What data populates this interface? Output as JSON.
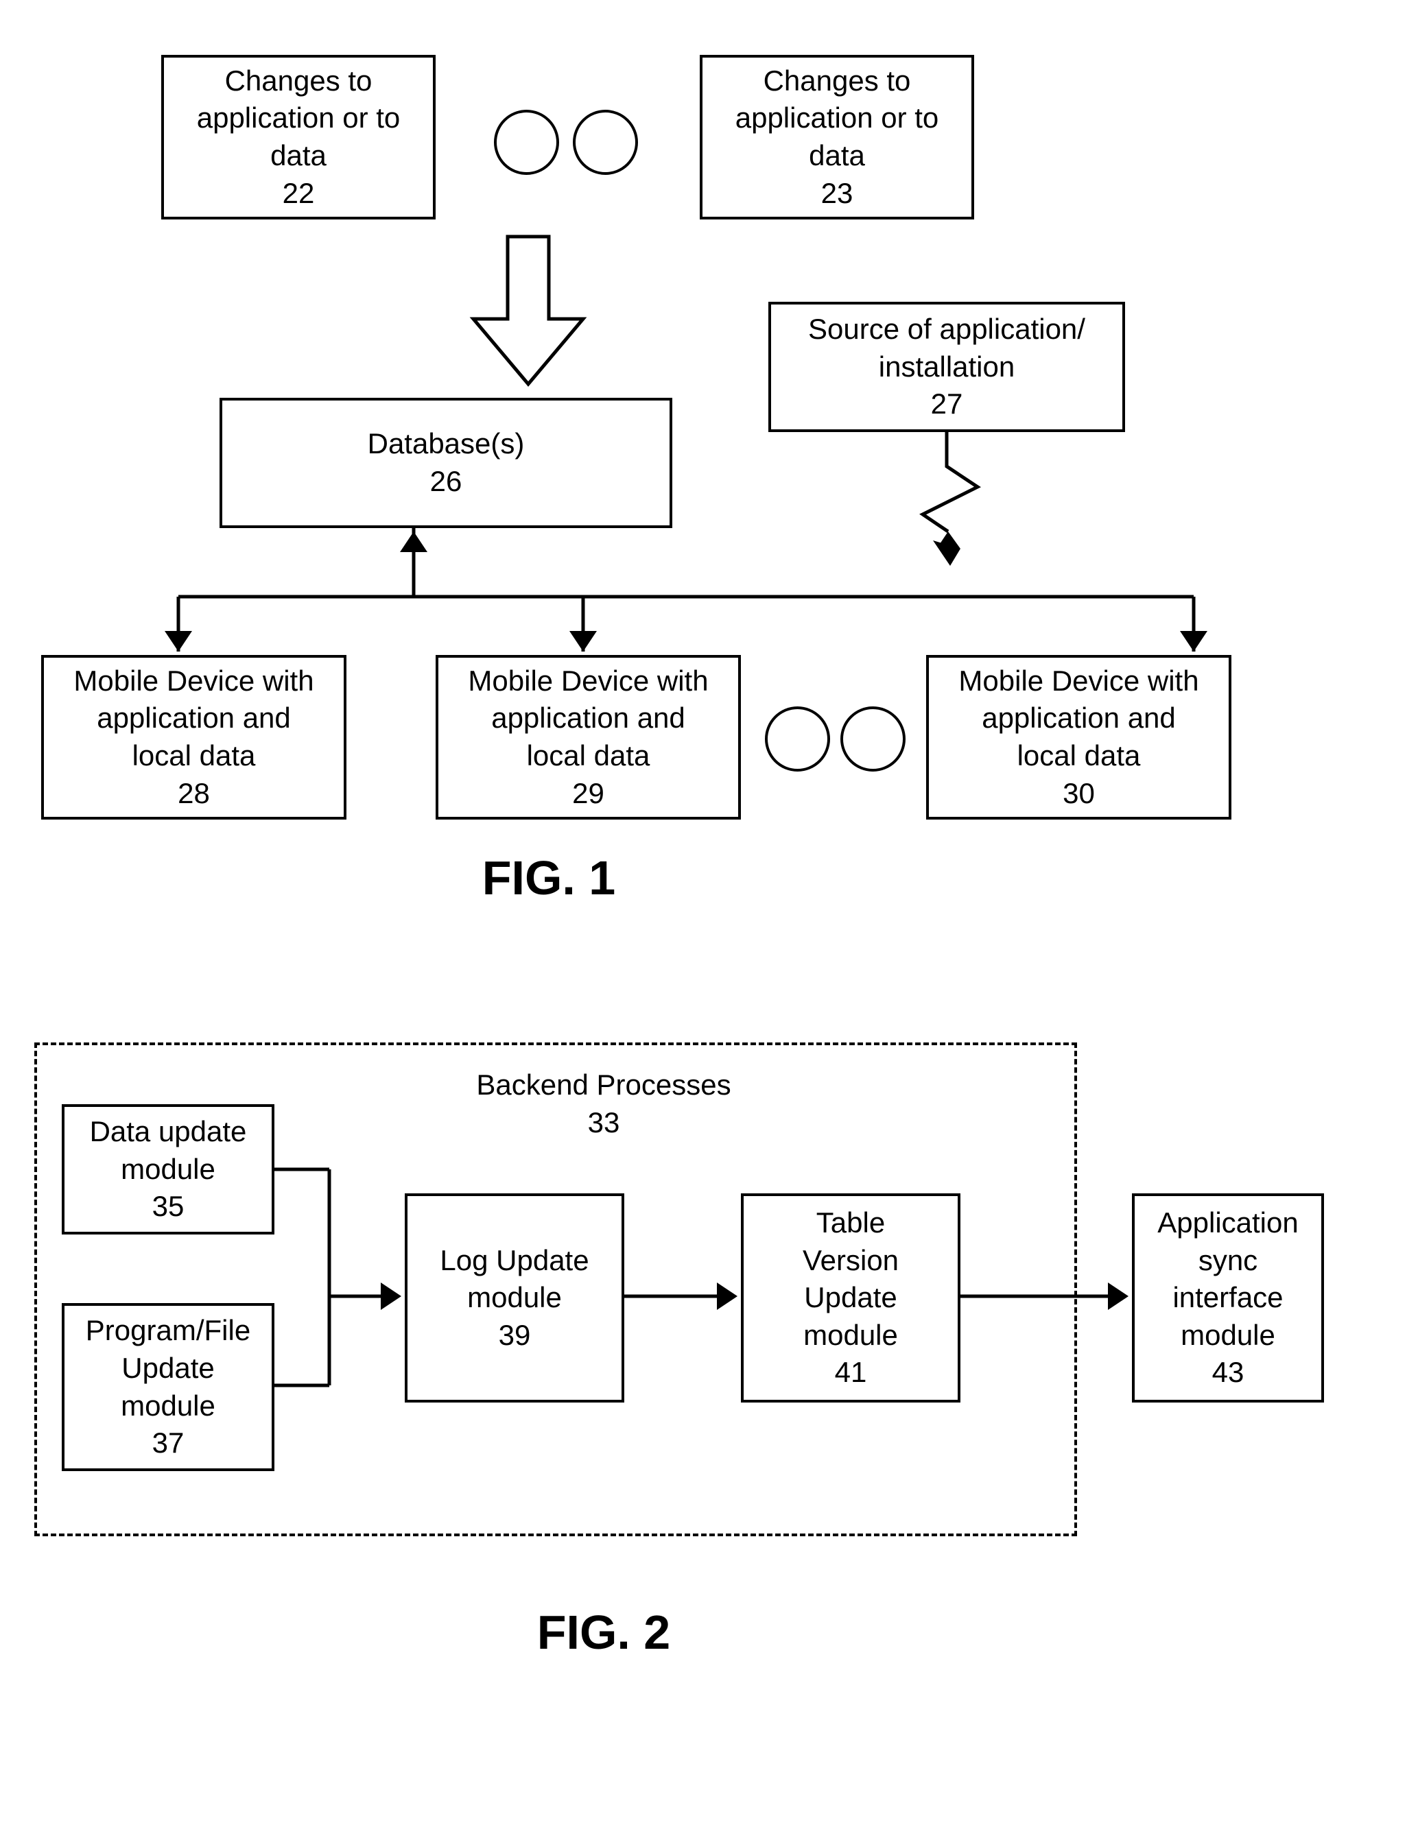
{
  "fig1": {
    "box22": {
      "line1": "Changes to",
      "line2": "application or to",
      "line3": "data",
      "num": "22"
    },
    "box23": {
      "line1": "Changes to",
      "line2": "application or to",
      "line3": "data",
      "num": "23"
    },
    "box26": {
      "line1": "Database(s)",
      "num": "26"
    },
    "box27": {
      "line1": "Source of application/",
      "line2": "installation",
      "num": "27"
    },
    "box28": {
      "line1": "Mobile Device with",
      "line2": "application and",
      "line3": "local data",
      "num": "28"
    },
    "box29": {
      "line1": "Mobile Device with",
      "line2": "application and",
      "line3": "local data",
      "num": "29"
    },
    "box30": {
      "line1": "Mobile Device with",
      "line2": "application and",
      "line3": "local data",
      "num": "30"
    },
    "label": "FIG. 1"
  },
  "fig2": {
    "title": {
      "line1": "Backend Processes",
      "num": "33"
    },
    "box35": {
      "line1": "Data update",
      "line2": "module",
      "num": "35"
    },
    "box37": {
      "line1": "Program/File",
      "line2": "Update",
      "line3": "module",
      "num": "37"
    },
    "box39": {
      "line1": "Log Update",
      "line2": "module",
      "num": "39"
    },
    "box41": {
      "line1": "Table",
      "line2": "Version",
      "line3": "Update",
      "line4": "module",
      "num": "41"
    },
    "box43": {
      "line1": "Application",
      "line2": "sync",
      "line3": "interface",
      "line4": "module",
      "num": "43"
    },
    "label": "FIG. 2"
  }
}
